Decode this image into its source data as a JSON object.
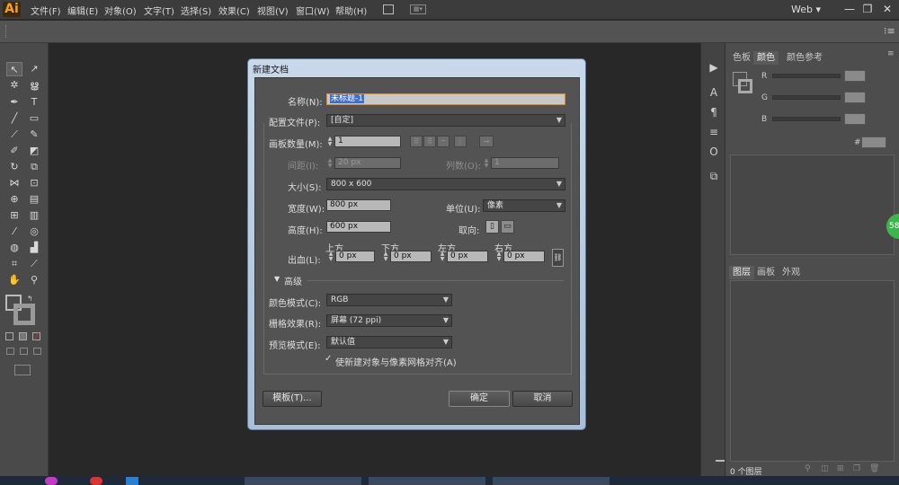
{
  "app": {
    "logo": "Ai",
    "workspace": "Web ▾"
  },
  "menu": [
    "文件(F)",
    "编辑(E)",
    "对象(O)",
    "文字(T)",
    "选择(S)",
    "效果(C)",
    "视图(V)",
    "窗口(W)",
    "帮助(H)"
  ],
  "window_buttons": {
    "minimize": "—",
    "restore": "❐",
    "close": "✕"
  },
  "color_panel": {
    "tabs": [
      "色板",
      "颜色",
      "颜色参考"
    ],
    "channels": [
      "R",
      "G",
      "B"
    ],
    "hex_label": "#"
  },
  "layers_panel": {
    "tabs": [
      "图层",
      "画板",
      "外观"
    ],
    "count": "0 个图层"
  },
  "badge": "58",
  "dialog": {
    "title": "新建文档",
    "name_label": "名称(N):",
    "name_value": "未标题-1",
    "profile_label": "配置文件(P):",
    "profile_value": "[自定]",
    "artboards_label": "画板数量(M):",
    "artboards_value": "1",
    "spacing_label": "间距(I):",
    "spacing_value": "20 px",
    "columns_label": "列数(O):",
    "columns_value": "1",
    "size_label": "大小(S):",
    "size_value": "800 x 600",
    "width_label": "宽度(W):",
    "width_value": "800 px",
    "units_label": "单位(U):",
    "units_value": "像素",
    "height_label": "高度(H):",
    "height_value": "600 px",
    "orientation_label": "取向:",
    "bleed_label": "出血(L):",
    "bleed_top_label": "上方",
    "bleed_bottom_label": "下方",
    "bleed_left_label": "左方",
    "bleed_right_label": "右方",
    "bleed_top": "0 px",
    "bleed_bottom": "0 px",
    "bleed_left": "0 px",
    "bleed_right": "0 px",
    "advanced_label": "高级",
    "color_mode_label": "颜色模式(C):",
    "color_mode_value": "RGB",
    "raster_label": "栅格效果(R):",
    "raster_value": "屏幕 (72 ppi)",
    "preview_label": "预览模式(E):",
    "preview_value": "默认值",
    "align_pixel_label": "使新建对象与像素网格对齐(A)",
    "templates_button": "模板(T)...",
    "ok_button": "确定",
    "cancel_button": "取消"
  }
}
